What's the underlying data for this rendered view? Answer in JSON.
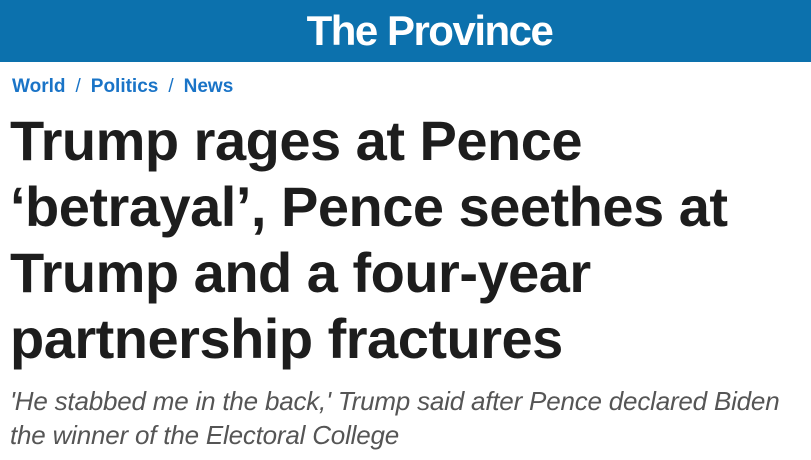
{
  "masthead": {
    "logo_text": "The Province",
    "background_color": "#0c71ad"
  },
  "breadcrumb": {
    "items": [
      "World",
      "Politics",
      "News"
    ],
    "separator": "/"
  },
  "article": {
    "headline": "Trump rages at Pence ‘betrayal’, Pence seethes at Trump and a four-year partnership fractures",
    "dek": "'He stabbed me in the back,' Trump said after Pence declared Biden the winner of the Electoral College"
  },
  "colors": {
    "link": "#1a74c7",
    "headline": "#1d1d1d",
    "dek": "#555555"
  }
}
